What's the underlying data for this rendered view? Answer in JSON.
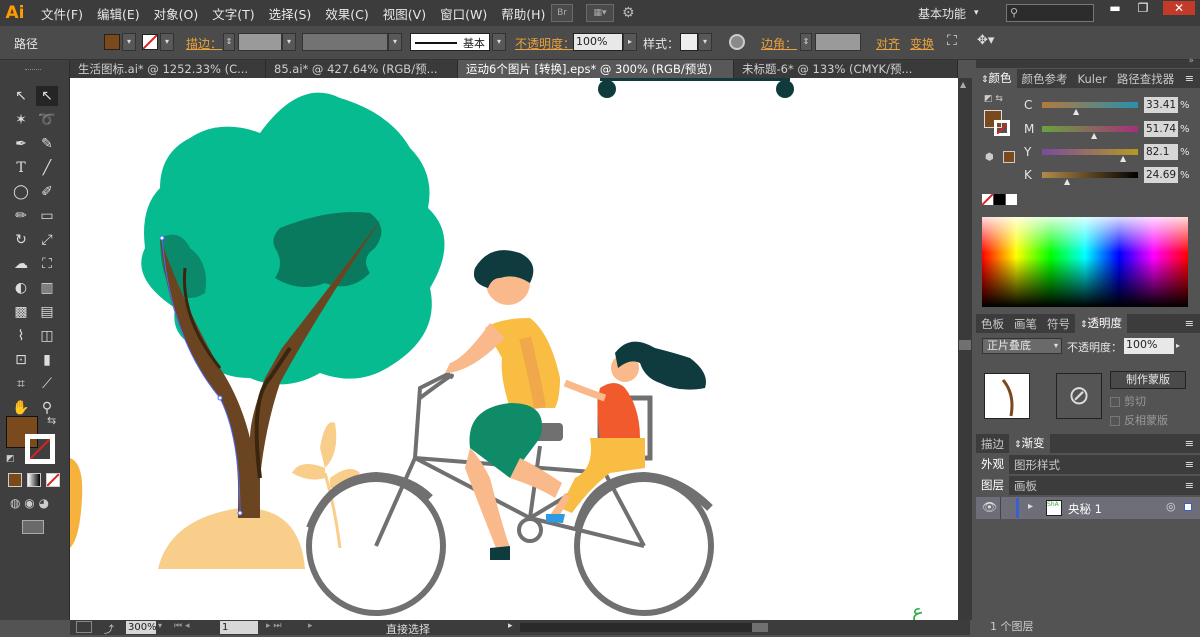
{
  "app": {
    "logo": "Ai",
    "workspace": "基本功能",
    "workspace_arrow": "▾",
    "br": "Br"
  },
  "menu": [
    "文件(F)",
    "编辑(E)",
    "对象(O)",
    "文字(T)",
    "选择(S)",
    "效果(C)",
    "视图(V)",
    "窗口(W)",
    "帮助(H)"
  ],
  "control": {
    "selection_type": "路径",
    "stroke_label": "描边：",
    "stroke_style": "基本",
    "opacity_label": "不透明度：",
    "opacity_value": "100%",
    "style_label": "样式：",
    "corner_label": "边角：",
    "align_label": "对齐",
    "transform_label": "变换",
    "fill_color": "#7a4a1d"
  },
  "tabs": [
    {
      "label": "生活图标.ai* @ 1252.33% (C..."
    },
    {
      "label": "85.ai* @ 427.64% (RGB/预..."
    },
    {
      "label": "运动6个图片 [转换].eps* @ 300% (RGB/预览)"
    },
    {
      "label": "未标题-6* @ 133% (CMYK/预..."
    }
  ],
  "status": {
    "zoom": "300%",
    "page": "1",
    "tool": "直接选择"
  },
  "color_panel": {
    "tabs": [
      "颜色",
      "颜色参考",
      "Kuler",
      "路径查找器"
    ],
    "channels": [
      {
        "name": "C",
        "value": "33.41",
        "pos": 0.33,
        "grad": "linear-gradient(90deg,#b37a3a,#2a8fae)"
      },
      {
        "name": "M",
        "value": "51.74",
        "pos": 0.52,
        "grad": "linear-gradient(90deg,#6aa23e,#a5307a)"
      },
      {
        "name": "Y",
        "value": "82.1",
        "pos": 0.82,
        "grad": "linear-gradient(90deg,#7a4aa0,#b59a20)"
      },
      {
        "name": "K",
        "value": "24.69",
        "pos": 0.25,
        "grad": "linear-gradient(90deg,#b58a4a,#000000)"
      }
    ],
    "unit": "%"
  },
  "transparency_panel": {
    "tabs": [
      "色板",
      "画笔",
      "符号",
      "透明度"
    ],
    "blend_mode": "正片叠底",
    "opacity_label": "不透明度：",
    "opacity_value": "100%",
    "make_mask": "制作蒙版",
    "clip": "剪切",
    "invert": "反相蒙版"
  },
  "stroke_gradient_tabs": [
    "描边",
    "渐变"
  ],
  "appearance_tabs": [
    "外观",
    "图形样式"
  ],
  "layers": {
    "tabs": [
      "图层",
      "画板"
    ],
    "layer_name": "央秘 1",
    "thumb_label": "ShA"
  },
  "watermark": "1 个图层"
}
